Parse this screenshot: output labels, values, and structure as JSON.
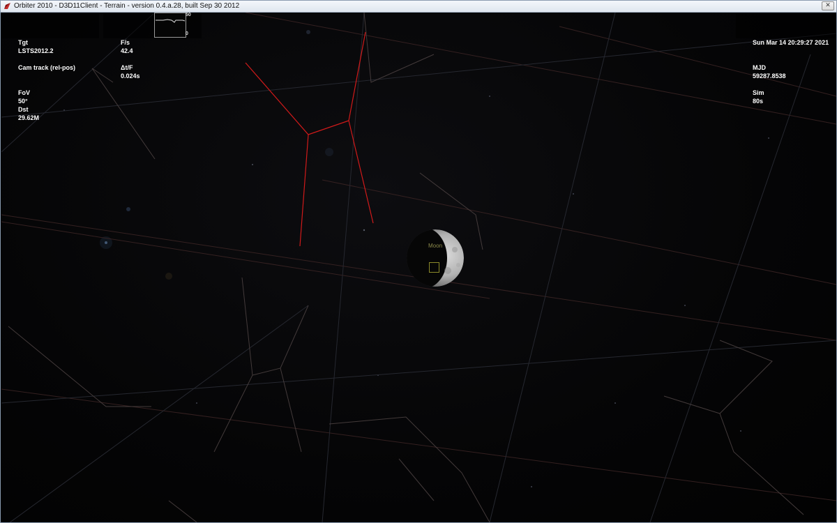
{
  "window": {
    "title": "Orbiter 2010 - D3D11Client - Terrain - version 0.4.a.28, built Sep 30 2012",
    "close_glyph": "✕",
    "icon": "orbiter-app-icon"
  },
  "hud_left": {
    "rows": [
      {
        "key": "Tgt",
        "value": "LSTS2012.2"
      },
      {
        "key": "Cam track (rel-pos)",
        "value": ""
      },
      {
        "key": "FoV",
        "value": "50°",
        "key2": "Dst",
        "value2": "29.62M"
      }
    ]
  },
  "hud_perf": {
    "fps_label": "F/s",
    "fps_value": "42.4",
    "dtf_label": "Δt/F",
    "dtf_value": "0.024s",
    "graph_max": "50",
    "graph_min": "0"
  },
  "hud_right": {
    "date": "Sun Mar 14 20:29:27 2021",
    "mjd_label": "MJD",
    "mjd_value": "59287.8538",
    "sim_label": "Sim",
    "sim_value": "80s"
  },
  "scene": {
    "moon_label": "Moon",
    "constellation_color": "#d11a1a",
    "grid_color": "#3a2a2a",
    "marker_color": "#8c8a2a"
  }
}
